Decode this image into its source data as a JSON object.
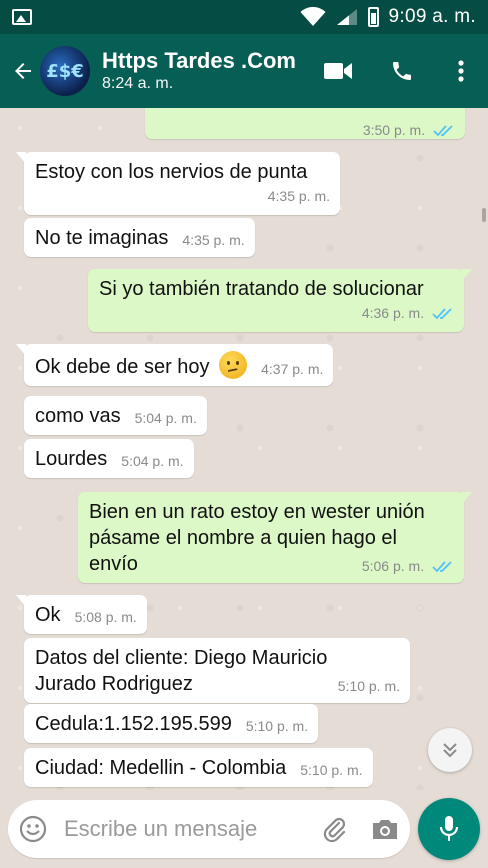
{
  "status_bar": {
    "time": "9:09 a. m.",
    "icons": [
      "image-icon",
      "wifi-icon",
      "signal-icon",
      "battery-icon"
    ]
  },
  "header": {
    "contact_name": "Https Tardes .Com",
    "contact_status": "8:24 a. m.",
    "avatar_symbols": "£$€",
    "actions": [
      "video-call-icon",
      "phone-icon",
      "more-vert-icon"
    ]
  },
  "colors": {
    "header": "#075e54",
    "status_bar": "#054d44",
    "bubble_out": "#dcf8c6",
    "bubble_in": "#ffffff",
    "tick_read": "#4fc3f7",
    "fab": "#00897b"
  },
  "messages": [
    {
      "dir": "out",
      "text": "",
      "time": "3:50 p. m.",
      "read": true
    },
    {
      "dir": "in",
      "text": "Estoy con los nervios de punta",
      "time": "4:35 p. m."
    },
    {
      "dir": "in",
      "text": "No te imaginas",
      "time": "4:35 p. m."
    },
    {
      "dir": "out",
      "text": "Si yo también tratando de solucionar",
      "time": "4:36 p. m.",
      "read": true
    },
    {
      "dir": "in",
      "text": "Ok debe de ser hoy",
      "emoji": "confused-face-emoji",
      "time": "4:37 p. m."
    },
    {
      "dir": "in",
      "text": "como vas",
      "time": "5:04 p. m."
    },
    {
      "dir": "in",
      "text": "Lourdes",
      "time": "5:04 p. m."
    },
    {
      "dir": "out",
      "lines": [
        "Bien en un rato estoy en wester unión",
        "pásame el nombre a quien hago el",
        "envío"
      ],
      "time": "5:06 p. m.",
      "read": true
    },
    {
      "dir": "in",
      "text": "Ok",
      "time": "5:08 p. m."
    },
    {
      "dir": "in",
      "lines": [
        "Datos del cliente: Diego Mauricio",
        "Jurado Rodriguez"
      ],
      "time": "5:10 p. m."
    },
    {
      "dir": "in",
      "text": "Cedula:1.152.195.599",
      "time": "5:10 p. m."
    },
    {
      "dir": "in",
      "text": "Ciudad: Medellin - Colombia",
      "time": "5:10 p. m."
    }
  ],
  "composer": {
    "placeholder": "Escribe un mensaje"
  }
}
